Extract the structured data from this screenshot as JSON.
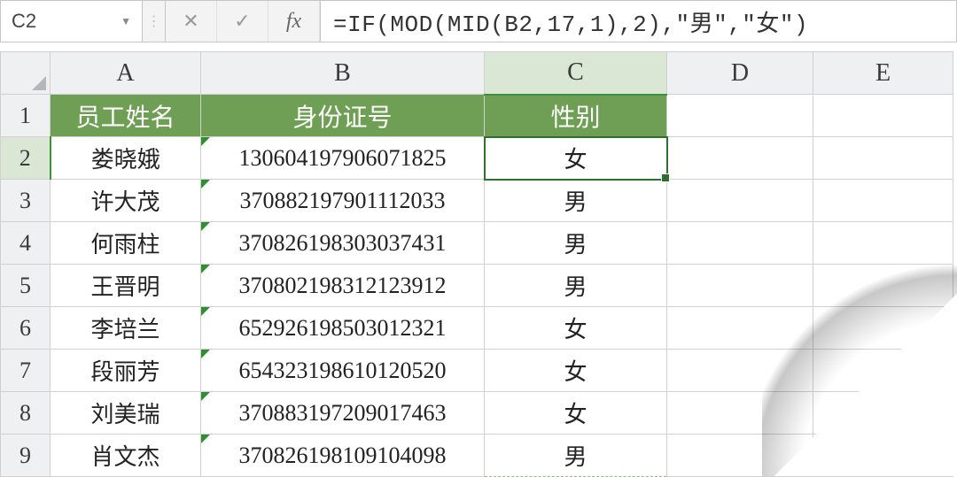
{
  "formula_bar": {
    "name_box": "C2",
    "cancel_glyph": "✕",
    "confirm_glyph": "✓",
    "fx_label": "fx",
    "formula": "=IF(MOD(MID(B2,17,1),2),\"男\",\"女\")"
  },
  "columns": [
    "A",
    "B",
    "C",
    "D",
    "E"
  ],
  "active_column_index": 2,
  "row_numbers": [
    1,
    2,
    3,
    4,
    5,
    6,
    7,
    8,
    9
  ],
  "active_row_index": 1,
  "header_row": {
    "A": "员工姓名",
    "B": "身份证号",
    "C": "性别"
  },
  "rows": [
    {
      "name": "娄晓娥",
      "id": "130604197906071825",
      "gender": "女"
    },
    {
      "name": "许大茂",
      "id": "370882197901112033",
      "gender": "男"
    },
    {
      "name": "何雨柱",
      "id": "370826198303037431",
      "gender": "男"
    },
    {
      "name": "王晋明",
      "id": "370802198312123912",
      "gender": "男"
    },
    {
      "name": "李培兰",
      "id": "652926198503012321",
      "gender": "女"
    },
    {
      "name": "段丽芳",
      "id": "654323198610120520",
      "gender": "女"
    },
    {
      "name": "刘美瑞",
      "id": "370883197209017463",
      "gender": "女"
    },
    {
      "name": "肖文杰",
      "id": "370826198109104098",
      "gender": "男"
    }
  ]
}
